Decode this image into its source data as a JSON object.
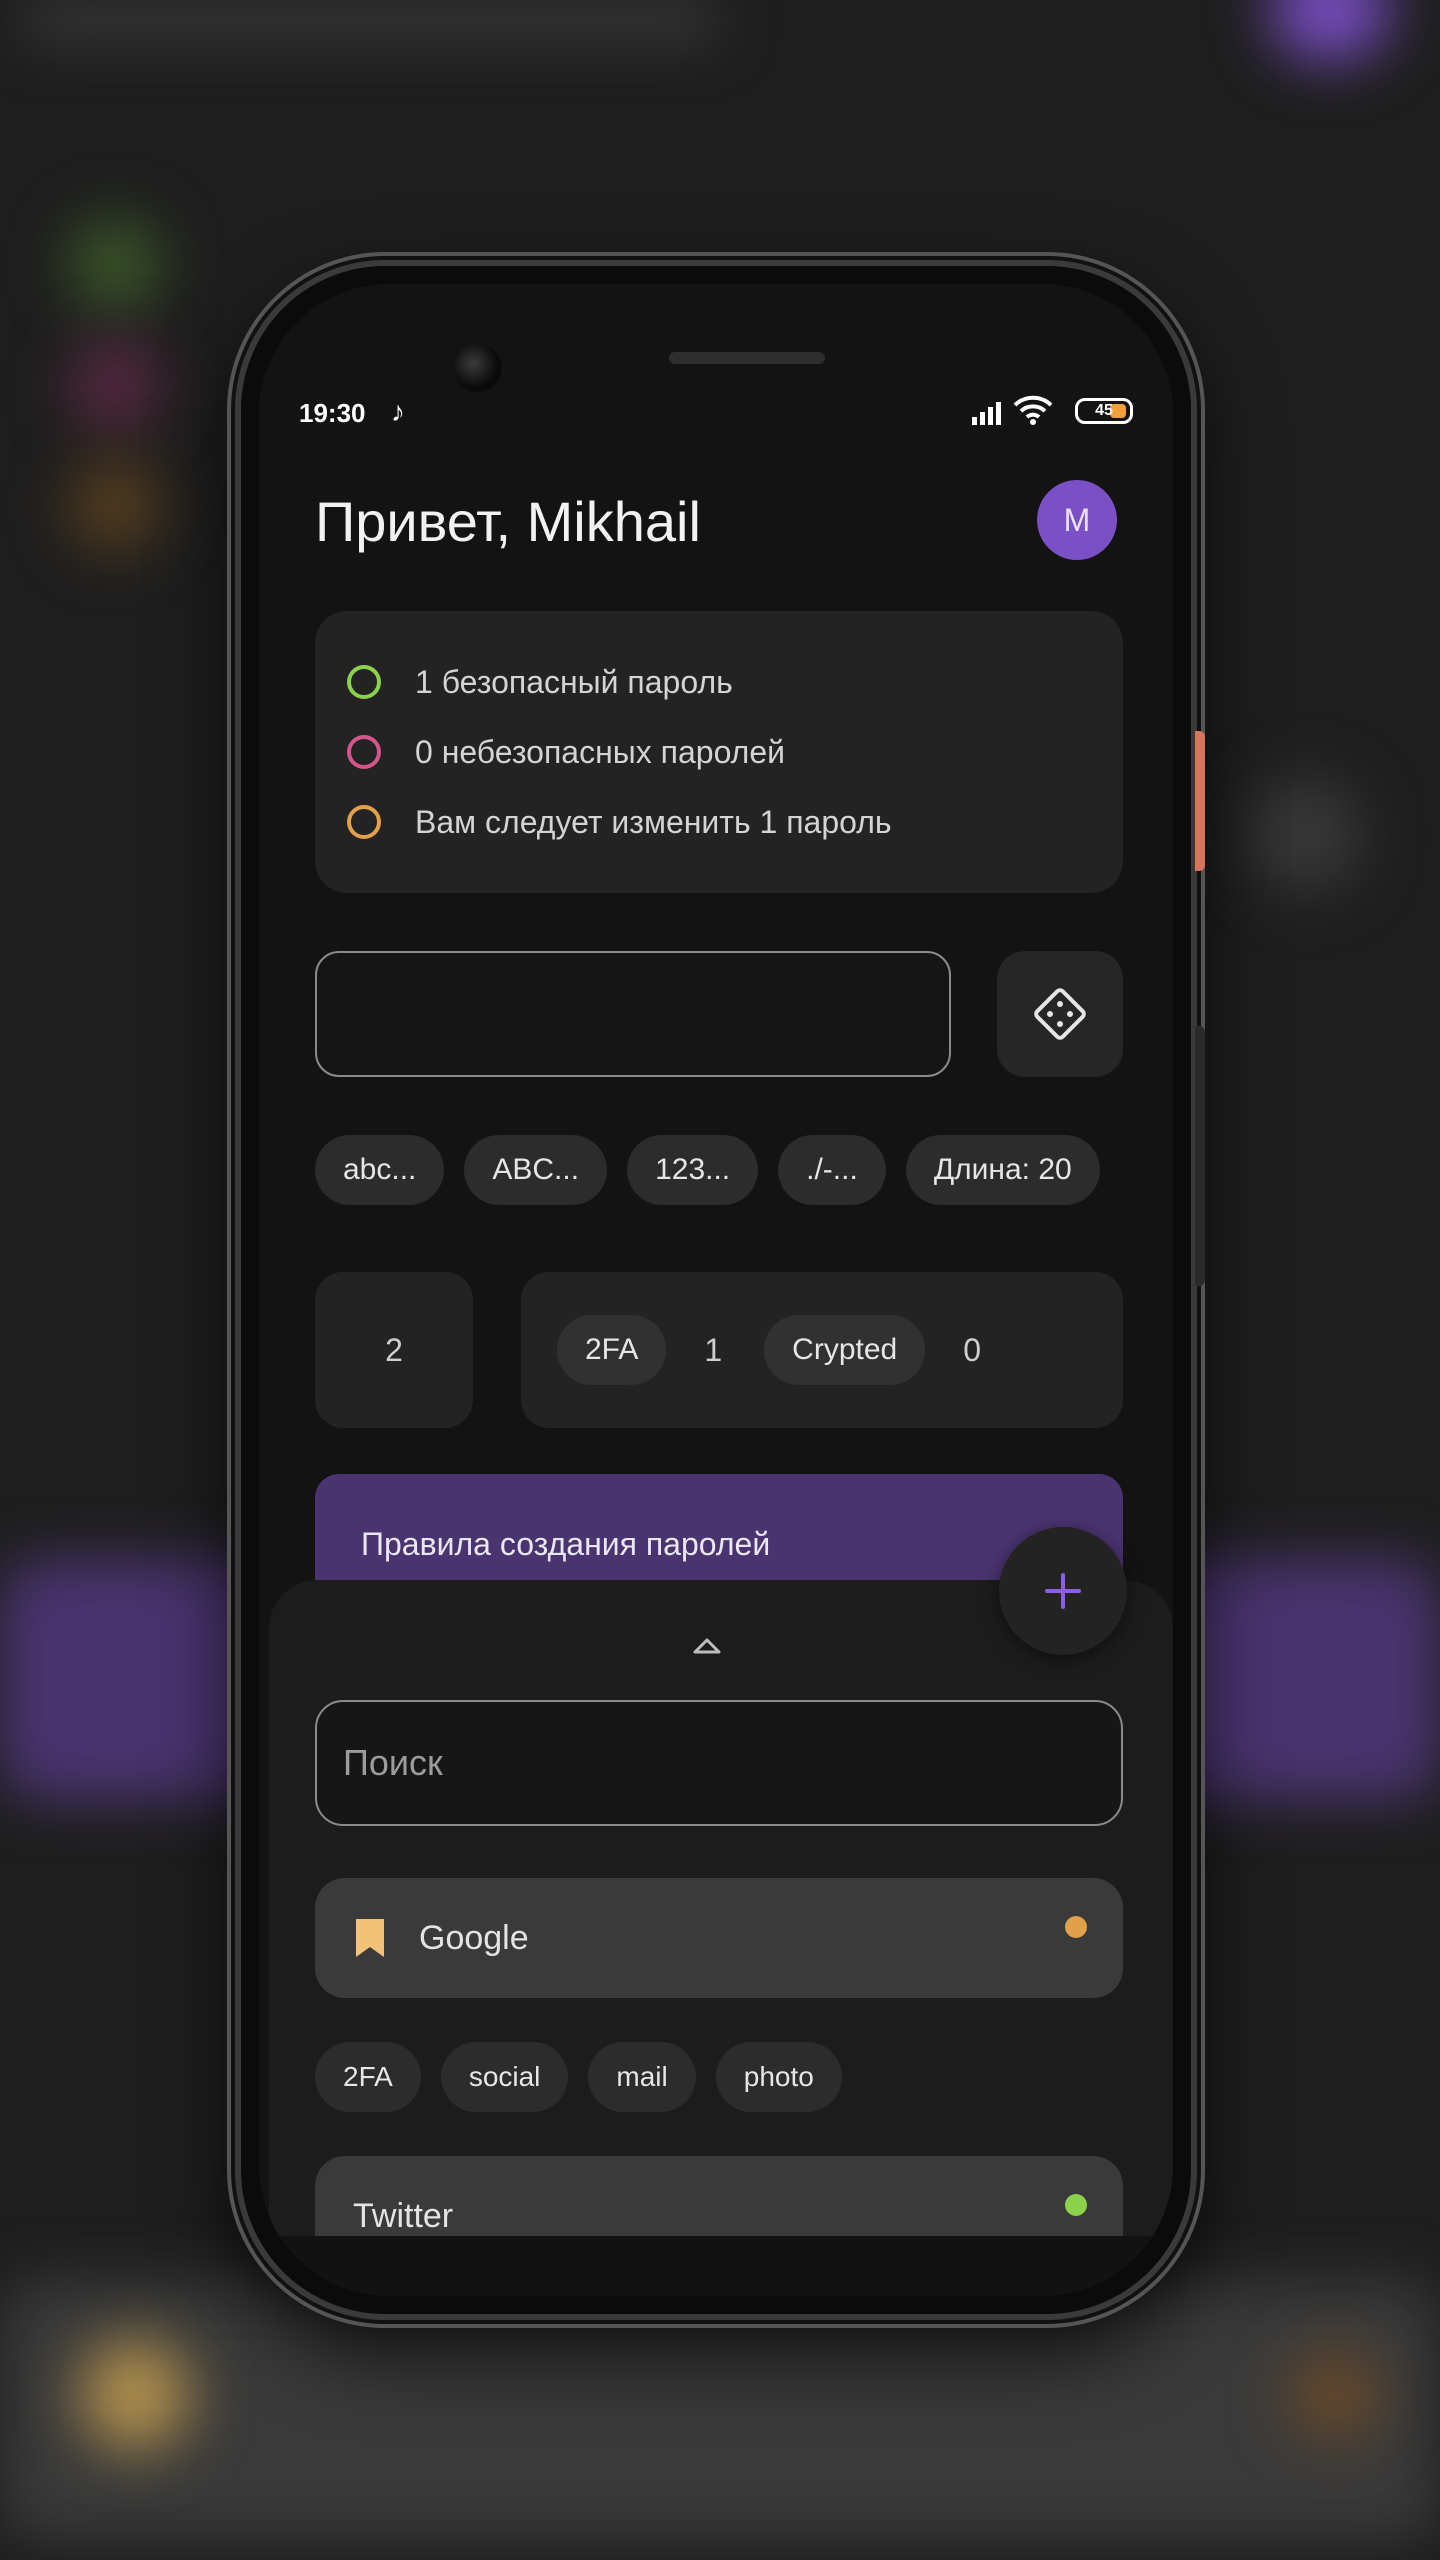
{
  "status_bar": {
    "time": "19:30",
    "battery": "45"
  },
  "header": {
    "greeting": "Привет, Mikhail",
    "avatar_initial": "M"
  },
  "summary": [
    {
      "text": "1 безопасный пароль",
      "color": "#8bd14a"
    },
    {
      "text": "0 небезопасных паролей",
      "color": "#d3558e"
    },
    {
      "text": "Вам следует изменить 1 пароль",
      "color": "#e1a04a"
    }
  ],
  "generator": {
    "value": "",
    "options": [
      "abc...",
      "ABC...",
      "123...",
      "./-...",
      "Длина: 20"
    ]
  },
  "stats": {
    "total": "2",
    "tags": [
      {
        "label": "2FA",
        "count": "1"
      },
      {
        "label": "Crypted",
        "count": "0"
      }
    ]
  },
  "rules_banner": "Правила создания паролей",
  "sheet": {
    "search_placeholder": "Поиск",
    "entries": [
      {
        "title": "Google",
        "status_color": "#e1a04a",
        "tags": [
          "2FA",
          "social",
          "mail",
          "photo"
        ]
      },
      {
        "title": "Twitter",
        "status_color": "#8bd14a"
      }
    ]
  },
  "colors": {
    "accent": "#7b4fc6",
    "fab_plus": "#8c5fe0",
    "bookmark": "#f2c278"
  }
}
